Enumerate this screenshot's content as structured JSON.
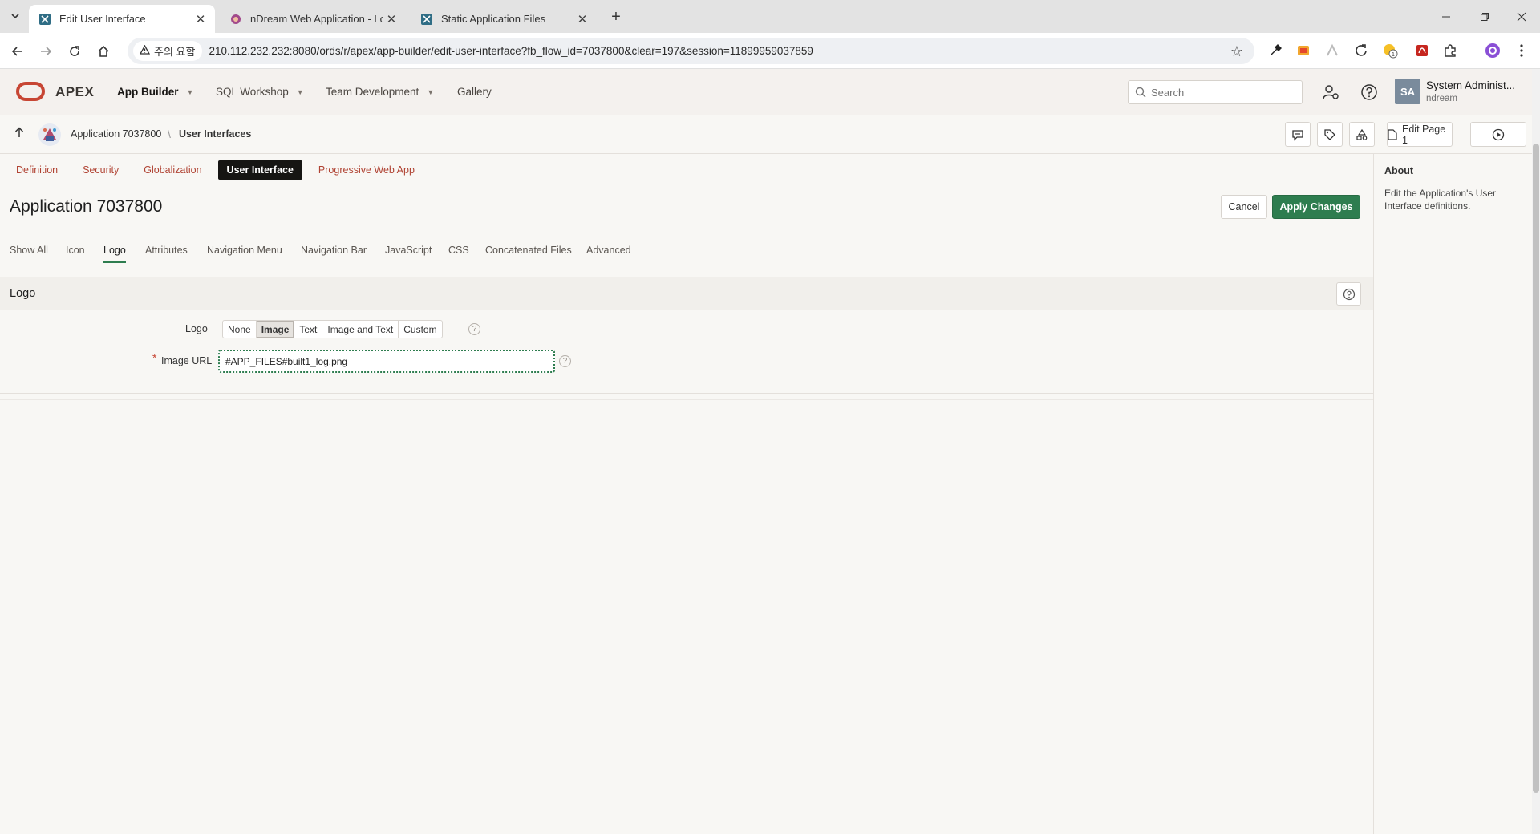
{
  "browser": {
    "tabs": [
      {
        "title": "Edit User Interface",
        "active": true
      },
      {
        "title": "nDream Web Application - Lo",
        "active": false
      },
      {
        "title": "Static Application Files",
        "active": false
      }
    ],
    "security_label": "주의 요함",
    "url": "210.112.232.232:8080/ords/r/apex/app-builder/edit-user-interface?fb_flow_id=7037800&clear=197&session=11899959037859"
  },
  "header": {
    "brand": "APEX",
    "nav": [
      {
        "label": "App Builder",
        "active": true
      },
      {
        "label": "SQL Workshop",
        "active": false
      },
      {
        "label": "Team Development",
        "active": false
      },
      {
        "label": "Gallery",
        "active": false
      }
    ],
    "search_placeholder": "Search",
    "avatar_initials": "SA",
    "user_name": "System Administ...",
    "workspace": "ndream"
  },
  "breadcrumb": {
    "app": "Application 7037800",
    "current": "User Interfaces",
    "edit_page_label": "Edit Page 1"
  },
  "page_tabs": [
    {
      "label": "Definition",
      "active": false
    },
    {
      "label": "Security",
      "active": false
    },
    {
      "label": "Globalization",
      "active": false
    },
    {
      "label": "User Interface",
      "active": true
    },
    {
      "label": "Progressive Web App",
      "active": false
    }
  ],
  "page": {
    "title": "Application 7037800",
    "cancel_label": "Cancel",
    "apply_label": "Apply Changes"
  },
  "sub_tabs": [
    "Show All",
    "Icon",
    "Logo",
    "Attributes",
    "Navigation Menu",
    "Navigation Bar",
    "JavaScript",
    "CSS",
    "Concatenated Files",
    "Advanced"
  ],
  "active_sub_tab": "Logo",
  "region": {
    "title": "Logo",
    "logo_label": "Logo",
    "logo_options": [
      "None",
      "Image",
      "Text",
      "Image and Text",
      "Custom"
    ],
    "logo_selected": "Image",
    "image_url_label": "Image URL",
    "image_url_value": "#APP_FILES#built1_log.png"
  },
  "side": {
    "title": "About",
    "text": "Edit the Application's User Interface definitions."
  },
  "colors": {
    "accent_green": "#2e7d4f",
    "oracle_red": "#c74634",
    "tab_link": "#b04333"
  }
}
